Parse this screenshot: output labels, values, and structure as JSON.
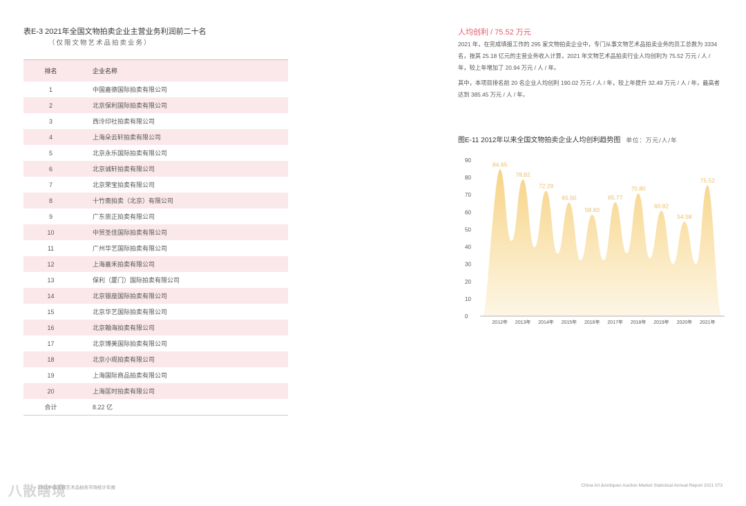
{
  "left": {
    "title": "表E-3   2021年全国文物拍卖企业主营业务利润前二十名",
    "subtitle": "（仅限文物艺术品拍卖业务）",
    "headers": [
      "排名",
      "企业名称"
    ],
    "rows": [
      [
        "1",
        "中国嘉德国际拍卖有限公司"
      ],
      [
        "2",
        "北京保利国际拍卖有限公司"
      ],
      [
        "3",
        "西泠印社拍卖有限公司"
      ],
      [
        "4",
        "上海朵云轩拍卖有限公司"
      ],
      [
        "5",
        "北京永乐国际拍卖有限公司"
      ],
      [
        "6",
        "北京诚轩拍卖有限公司"
      ],
      [
        "7",
        "北京荣宝拍卖有限公司"
      ],
      [
        "8",
        "十竹斋拍卖（北京）有限公司"
      ],
      [
        "9",
        "广东崇正拍卖有限公司"
      ],
      [
        "10",
        "中贸圣佳国际拍卖有限公司"
      ],
      [
        "11",
        "广州华艺国际拍卖有限公司"
      ],
      [
        "12",
        "上海嘉禾拍卖有限公司"
      ],
      [
        "13",
        "保利（厦门）国际拍卖有限公司"
      ],
      [
        "14",
        "北京银座国际拍卖有限公司"
      ],
      [
        "15",
        "北京华艺国际拍卖有限公司"
      ],
      [
        "16",
        "北京翰海拍卖有限公司"
      ],
      [
        "17",
        "北京博美国际拍卖有限公司"
      ],
      [
        "18",
        "北京小观拍卖有限公司"
      ],
      [
        "19",
        "上海国际商品拍卖有限公司"
      ],
      [
        "20",
        "上海匡时拍卖有限公司"
      ]
    ],
    "total": [
      "合计",
      "8.22 亿"
    ]
  },
  "right": {
    "heading": "人均创利 / 75.52 万元",
    "para1": "2021 年，在完成填报工作的 295 家文物拍卖企业中，专门从事文物艺术品拍卖业务的员工总数为 3334 名，按其 25.18 亿元的主营业务收入计算，2021 年文物艺术品拍卖行业人均创利为 75.52 万元 / 人 / 年，较上年增加了 20.94 万元 / 人 / 年。",
    "para2": "其中，本项目排名前 20 名企业人均创利 190.02 万元 / 人 / 年，较上年提升 32.49 万元 / 人 / 年，最高者达到 385.45 万元 / 人 / 年。",
    "fig_title": "图E-11    2012年以来全国文物拍卖企业人均创利趋势图",
    "fig_unit": "单位：万元/人/年"
  },
  "chart_data": {
    "type": "area",
    "title": "2012年以来全国文物拍卖企业人均创利趋势图",
    "unit": "万元/人/年",
    "categories": [
      "2012年",
      "2013年",
      "2014年",
      "2015年",
      "2016年",
      "2017年",
      "2018年",
      "2019年",
      "2020年",
      "2021年"
    ],
    "values": [
      84.65,
      78.82,
      72.29,
      65.5,
      58.6,
      65.77,
      70.8,
      60.82,
      54.58,
      75.52
    ],
    "value_labels": [
      "84.65",
      "78.82",
      "72.29",
      "65.50",
      "58.60",
      "65.77",
      "70.80",
      "60.82",
      "54.58",
      "75.52"
    ],
    "ylim": [
      0,
      90
    ],
    "yticks": [
      "0",
      "10",
      "20",
      "30",
      "40",
      "50",
      "60",
      "70",
      "80",
      "90"
    ],
    "colors": {
      "fill_top": "#f7d486",
      "fill_bottom": "#fdf6e6",
      "label": "#e9bd68"
    },
    "grid": false,
    "legend": "none"
  },
  "footer": {
    "left": "2021中国文物艺术品拍卖市场统计年报",
    "right": "China Art &Antiques Auction Market Statistical Annual Report  2021    073",
    "watermark": "八散瞎境"
  }
}
